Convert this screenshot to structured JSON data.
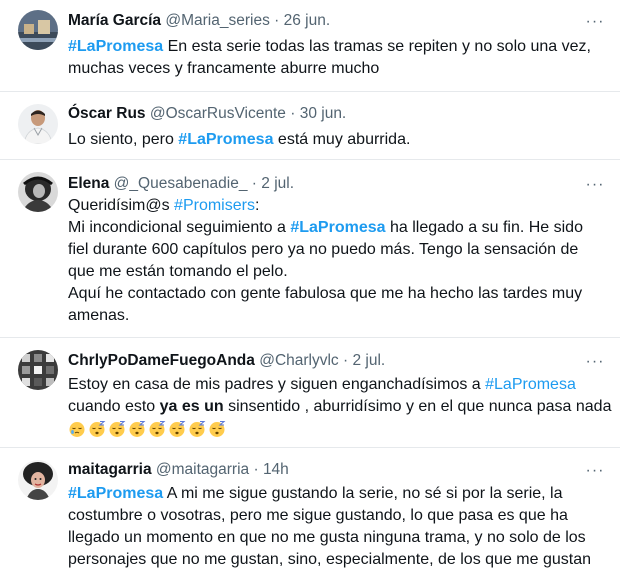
{
  "tweets": [
    {
      "name": "María García",
      "handle": "@Maria_series",
      "date": "26 jun.",
      "lines": [
        {
          "tag": "#LaPromesa",
          "rest": " En esta serie todas las tramas se repiten y no solo una vez,"
        },
        {
          "text": "muchas veces y francamente aburre mucho"
        }
      ]
    },
    {
      "name": "Óscar Rus",
      "handle": "@OscarRusVicente",
      "date": "30 jun.",
      "line": {
        "pre": "Lo siento, pero ",
        "tag": "#LaPromesa",
        "post": " está muy aburrida."
      }
    },
    {
      "name": "Elena",
      "handle": "@_Quesabenadie_",
      "date": "2 jul.",
      "line1": {
        "pre": "Queridísim@s ",
        "tag": "#Promisers",
        "post": ":"
      },
      "line2": {
        "pre": "Mi incondicional seguimiento a ",
        "tag": "#LaPromesa",
        "post": " ha llegado a su fin. He sido"
      },
      "lines_rest": [
        "fiel durante 600 capítulos pero ya no puedo más. Tengo la sensación de",
        "que me están tomando el pelo.",
        "Aquí he contactado con gente fabulosa que me ha hecho las tardes muy",
        "amenas."
      ]
    },
    {
      "name": "ChrlyPoDameFuegoAnda",
      "handle": "@Charlyvlc",
      "date": "2 jul.",
      "line1": {
        "pre": "Estoy en casa de mis padres y siguen enganchadísimos a ",
        "tag": "#LaPromesa"
      },
      "line2": {
        "pre": "cuando esto ",
        "bold": "ya es un",
        "post": " sinsentido , aburridísimo y en el que nunca pasa nada"
      },
      "emojis": [
        "sleepy-face",
        "sleeping-face",
        "sleeping-face",
        "sleeping-face",
        "sleeping-face",
        "sleeping-face",
        "sleeping-face",
        "sleeping-face"
      ]
    },
    {
      "name": "maitagarria",
      "handle": "@maitagarria",
      "date": "14h",
      "line1": {
        "tag": "#LaPromesa",
        "post": " A mi me sigue gustando la serie, no sé si por la serie, la"
      },
      "lines_rest": [
        "costumbre o vosotras, pero me sigue gustando, lo que pasa es que ha",
        "llegado un momento en que no me gusta ninguna trama, y no solo de los",
        "personajes que no me gustan, sino, especialmente, de los que me gustan"
      ]
    }
  ],
  "ui": {
    "separator": " · ",
    "more_icon": "···",
    "tag_color": "#1d9bf0",
    "meta_color": "#536471"
  }
}
